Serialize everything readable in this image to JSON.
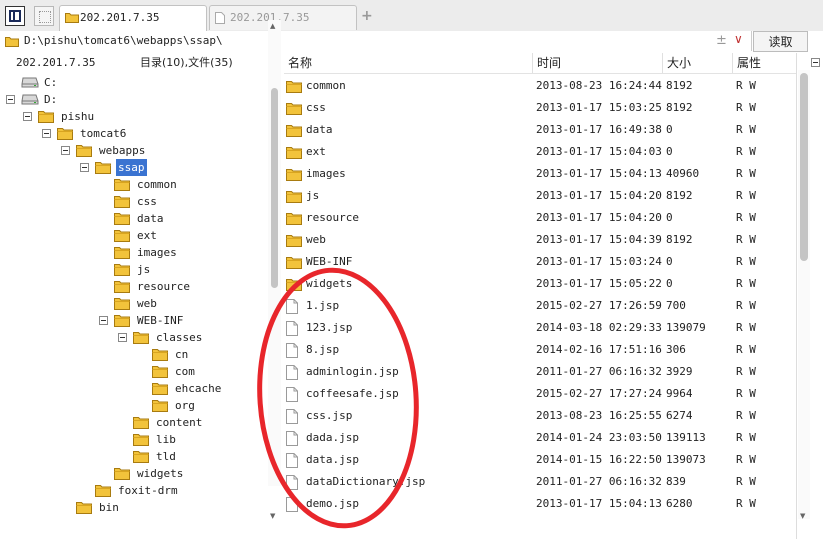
{
  "tabs": [
    {
      "label": "202.201.7.35",
      "active": true
    },
    {
      "label": "202.201.7.35",
      "active": false
    }
  ],
  "address": {
    "path": "D:\\pishu\\tomcat6\\webapps\\ssap\\",
    "read_label": "读取"
  },
  "tree": {
    "host": "202.201.7.35",
    "count_label": "目录(10),文件(35)",
    "nodes": [
      {
        "label": "C:",
        "kind": "drive"
      },
      {
        "label": "D:",
        "kind": "drive"
      },
      {
        "label": "pishu",
        "kind": "folder"
      },
      {
        "label": "tomcat6",
        "kind": "folder"
      },
      {
        "label": "webapps",
        "kind": "folder"
      },
      {
        "label": "ssap",
        "kind": "folder",
        "selected": true
      },
      {
        "label": "common",
        "kind": "folder"
      },
      {
        "label": "css",
        "kind": "folder"
      },
      {
        "label": "data",
        "kind": "folder"
      },
      {
        "label": "ext",
        "kind": "folder"
      },
      {
        "label": "images",
        "kind": "folder"
      },
      {
        "label": "js",
        "kind": "folder"
      },
      {
        "label": "resource",
        "kind": "folder"
      },
      {
        "label": "web",
        "kind": "folder"
      },
      {
        "label": "WEB-INF",
        "kind": "folder"
      },
      {
        "label": "classes",
        "kind": "folder"
      },
      {
        "label": "cn",
        "kind": "folder"
      },
      {
        "label": "com",
        "kind": "folder"
      },
      {
        "label": "ehcache",
        "kind": "folder"
      },
      {
        "label": "org",
        "kind": "folder"
      },
      {
        "label": "content",
        "kind": "folder"
      },
      {
        "label": "lib",
        "kind": "folder"
      },
      {
        "label": "tld",
        "kind": "folder"
      },
      {
        "label": "widgets",
        "kind": "folder"
      },
      {
        "label": "foxit-drm",
        "kind": "folder"
      },
      {
        "label": "bin",
        "kind": "folder"
      }
    ]
  },
  "list": {
    "columns": {
      "name": "名称",
      "time": "时间",
      "size": "大小",
      "attr": "属性"
    },
    "rows": [
      {
        "name": "common",
        "kind": "folder",
        "time": "2013-08-23 16:24:44",
        "size": "8192",
        "attr": "R W"
      },
      {
        "name": "css",
        "kind": "folder",
        "time": "2013-01-17 15:03:25",
        "size": "8192",
        "attr": "R W"
      },
      {
        "name": "data",
        "kind": "folder",
        "time": "2013-01-17 16:49:38",
        "size": "0",
        "attr": "R W"
      },
      {
        "name": "ext",
        "kind": "folder",
        "time": "2013-01-17 15:04:03",
        "size": "0",
        "attr": "R W"
      },
      {
        "name": "images",
        "kind": "folder",
        "time": "2013-01-17 15:04:13",
        "size": "40960",
        "attr": "R W"
      },
      {
        "name": "js",
        "kind": "folder",
        "time": "2013-01-17 15:04:20",
        "size": "8192",
        "attr": "R W"
      },
      {
        "name": "resource",
        "kind": "folder",
        "time": "2013-01-17 15:04:20",
        "size": "0",
        "attr": "R W"
      },
      {
        "name": "web",
        "kind": "folder",
        "time": "2013-01-17 15:04:39",
        "size": "8192",
        "attr": "R W"
      },
      {
        "name": "WEB-INF",
        "kind": "folder",
        "time": "2013-01-17 15:03:24",
        "size": "0",
        "attr": "R W"
      },
      {
        "name": "widgets",
        "kind": "folder",
        "time": "2013-01-17 15:05:22",
        "size": "0",
        "attr": "R W"
      },
      {
        "name": "1.jsp",
        "kind": "file",
        "time": "2015-02-27 17:26:59",
        "size": "700",
        "attr": "R W"
      },
      {
        "name": "123.jsp",
        "kind": "file",
        "time": "2014-03-18 02:29:33",
        "size": "139079",
        "attr": "R W"
      },
      {
        "name": "8.jsp",
        "kind": "file",
        "time": "2014-02-16 17:51:16",
        "size": "306",
        "attr": "R W"
      },
      {
        "name": "adminlogin.jsp",
        "kind": "file",
        "time": "2011-01-27 06:16:32",
        "size": "3929",
        "attr": "R W"
      },
      {
        "name": "coffeesafe.jsp",
        "kind": "file",
        "time": "2015-02-27 17:27:24",
        "size": "9964",
        "attr": "R W"
      },
      {
        "name": "css.jsp",
        "kind": "file",
        "time": "2013-08-23 16:25:55",
        "size": "6274",
        "attr": "R W"
      },
      {
        "name": "dada.jsp",
        "kind": "file",
        "time": "2014-01-24 23:03:50",
        "size": "139113",
        "attr": "R W"
      },
      {
        "name": "data.jsp",
        "kind": "file",
        "time": "2014-01-15 16:22:50",
        "size": "139073",
        "attr": "R W"
      },
      {
        "name": "dataDictionary.jsp",
        "kind": "file",
        "time": "2011-01-27 06:16:32",
        "size": "839",
        "attr": "R W"
      },
      {
        "name": "demo.jsp",
        "kind": "file",
        "time": "2013-01-17 15:04:13",
        "size": "6280",
        "attr": "R W"
      }
    ]
  },
  "colors": {
    "accent": "#3a73d1",
    "folder": "#f2c33b",
    "annotation": "#e8262b"
  }
}
